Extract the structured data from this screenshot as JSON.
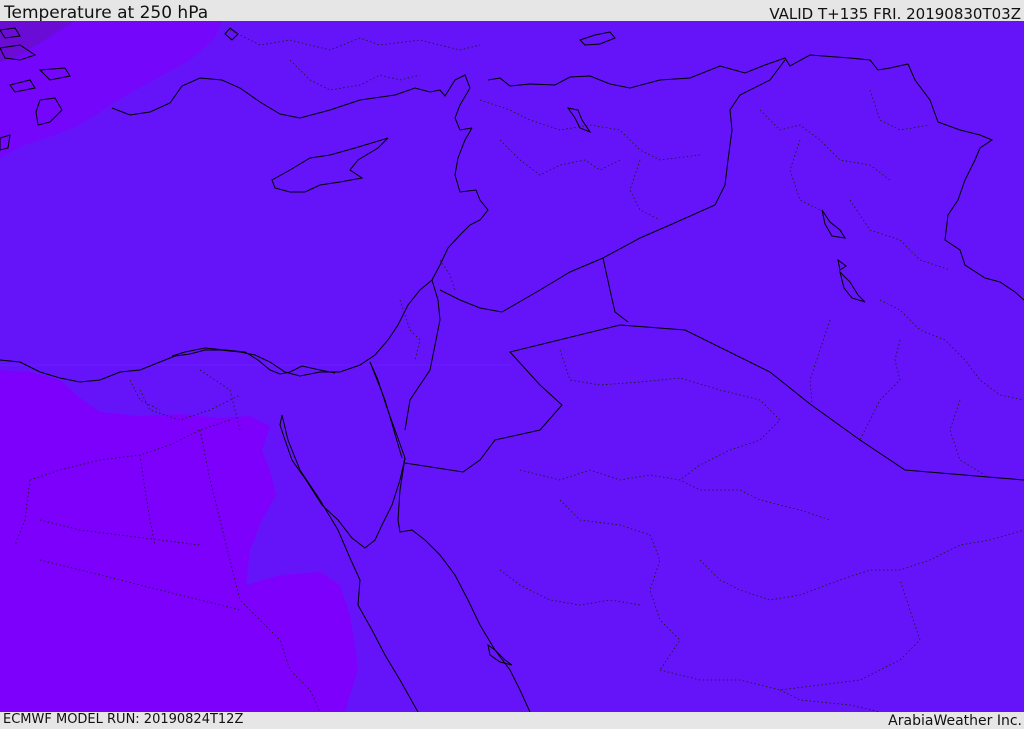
{
  "header": {
    "title": "Temperature at 250 hPa",
    "valid": "VALID T+135 FRI. 20190830T03Z"
  },
  "footer": {
    "model_run": "ECMWF MODEL RUN: 20190824T12Z",
    "credit": "ArabiaWeather Inc."
  },
  "map": {
    "field": "temperature",
    "level": "250 hPa",
    "colors": {
      "main_shade": "#6514fa",
      "warm_shade": "#7d00fc",
      "warmer_shade": "#6c0cd8",
      "border_line": "#000000",
      "sub_border_line": "#2a2a2a"
    }
  }
}
